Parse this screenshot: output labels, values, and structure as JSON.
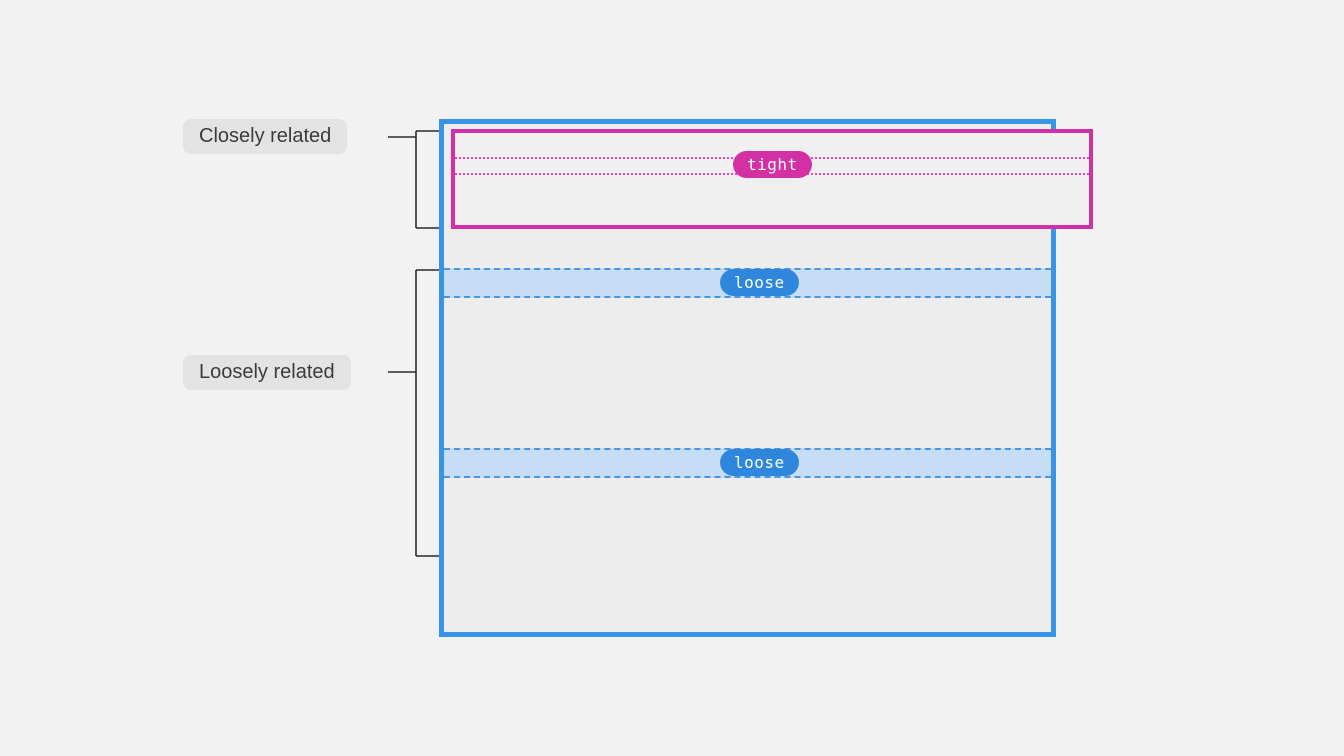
{
  "labels": {
    "closely": "Closely related",
    "loosely": "Loosely related"
  },
  "badges": {
    "tight": "tight",
    "loose1": "loose",
    "loose2": "loose"
  },
  "colors": {
    "outer_border": "#3894e6",
    "tight_border": "#d330a3",
    "tight_badge": "#d330a3",
    "loose_badge": "#2f87dd",
    "loose_band_bg": "#c6ddf6",
    "loose_band_border": "#4a95dd",
    "label_pill_bg": "#e3e3e3",
    "page_bg": "#f2f2f2"
  }
}
